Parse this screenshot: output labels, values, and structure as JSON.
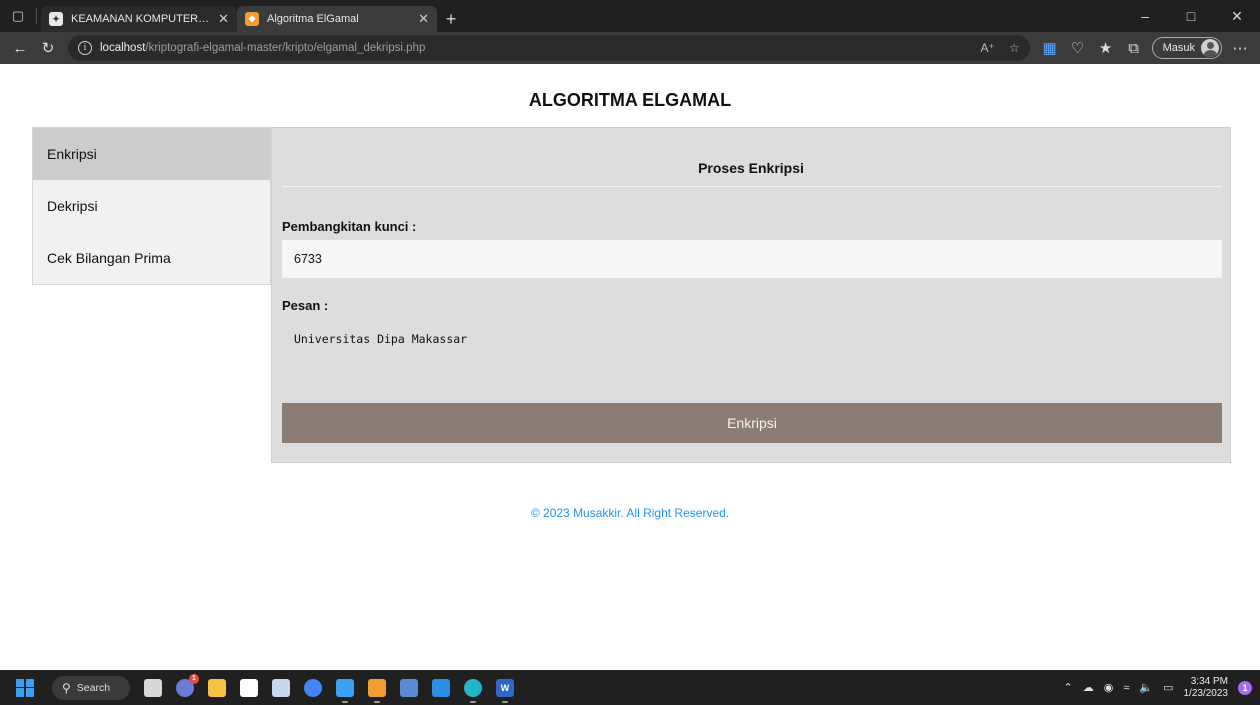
{
  "browser": {
    "tabs": [
      {
        "title": "KEAMANAN KOMPUTER/KRIPTOGRAFI",
        "favicon_color": "#e8e8e8",
        "active": false
      },
      {
        "title": "Algoritma ElGamal",
        "favicon_color": "#f39c34",
        "active": true
      }
    ],
    "new_tab_symbol": "+",
    "address": {
      "host": "localhost",
      "path": "/kriptografi-elgamal-master/kripto/elgamal_dekripsi.php"
    },
    "profile_label": "Masuk"
  },
  "page": {
    "title": "ALGORITMA ELGAMAL",
    "sidebar": {
      "items": [
        {
          "label": "Enkripsi",
          "active": true
        },
        {
          "label": "Dekripsi",
          "active": false
        },
        {
          "label": "Cek Bilangan Prima",
          "active": false
        }
      ]
    },
    "panel": {
      "title": "Proses Enkripsi",
      "key_label": "Pembangkitan kunci :",
      "key_value": "6733",
      "message_label": "Pesan :",
      "message_value": "Universitas Dipa Makassar",
      "button_label": "Enkripsi",
      "button_color": "#8b7d73"
    },
    "footer": "© 2023 Musakkir. All Right Reserved."
  },
  "taskbar": {
    "search_label": "Search",
    "time": "3:34 PM",
    "date": "1/23/2023",
    "notification_count": "1",
    "badge_count": "1"
  }
}
